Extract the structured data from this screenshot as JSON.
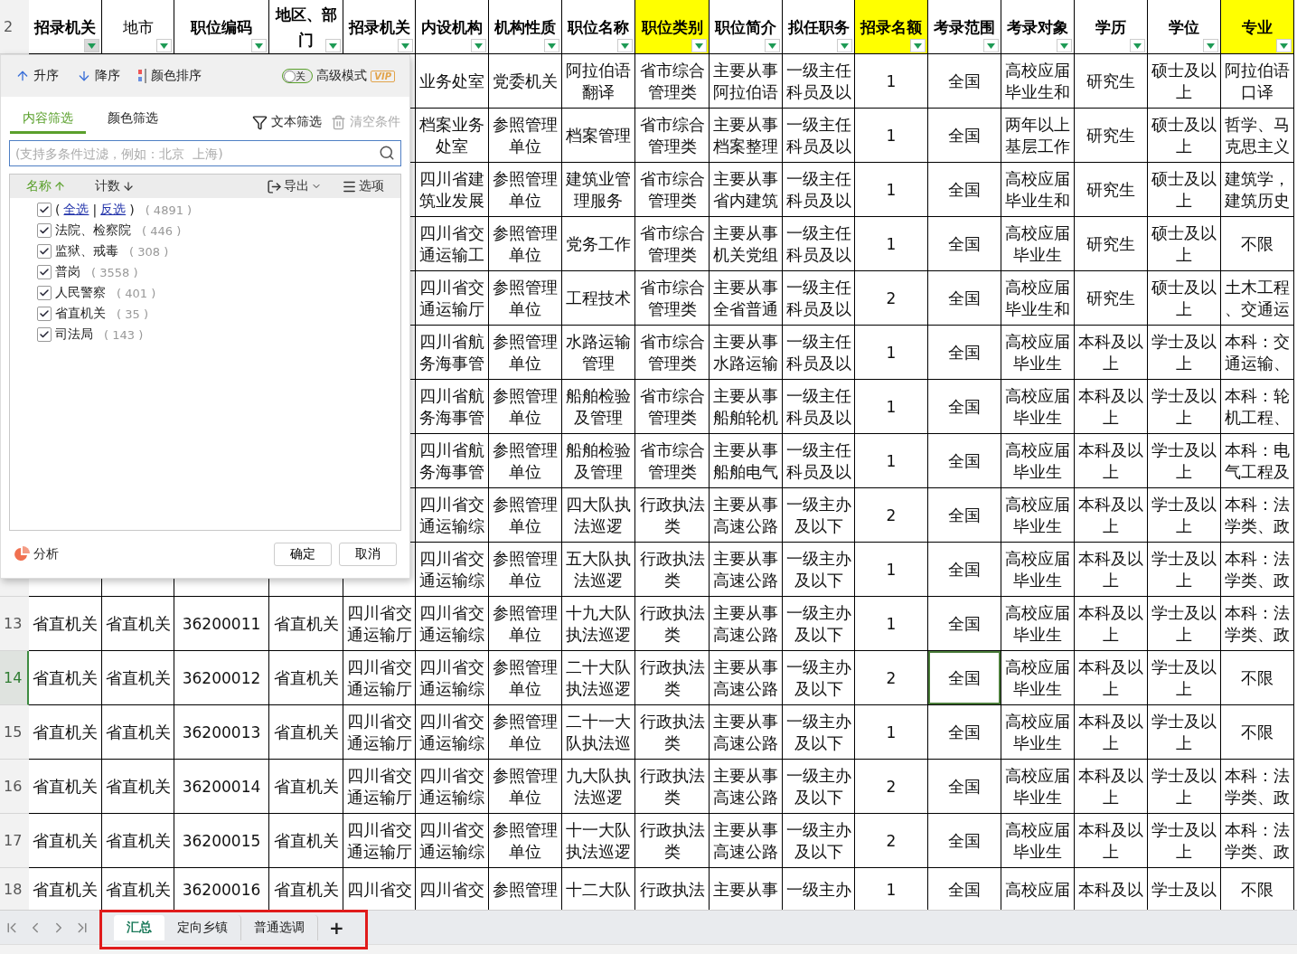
{
  "header_row": {
    "num": "2"
  },
  "columns": [
    {
      "label": "招录机关",
      "bold": true,
      "highlighted": false,
      "filter_open": true
    },
    {
      "label": "地市",
      "bold": false,
      "highlighted": false,
      "filter_open": false
    },
    {
      "label": "职位编码",
      "bold": true,
      "highlighted": false,
      "filter_open": false
    },
    {
      "label": "地区、部门",
      "bold": true,
      "highlighted": false,
      "filter_open": false
    },
    {
      "label": "招录机关",
      "bold": true,
      "highlighted": false,
      "filter_open": false
    },
    {
      "label": "内设机构",
      "bold": true,
      "highlighted": false,
      "filter_open": false
    },
    {
      "label": "机构性质",
      "bold": true,
      "highlighted": false,
      "filter_open": false
    },
    {
      "label": "职位名称",
      "bold": true,
      "highlighted": false,
      "filter_open": false
    },
    {
      "label": "职位类别",
      "bold": true,
      "highlighted": true,
      "filter_open": false
    },
    {
      "label": "职位简介",
      "bold": true,
      "highlighted": false,
      "filter_open": false
    },
    {
      "label": "拟任职务",
      "bold": true,
      "highlighted": false,
      "filter_open": false
    },
    {
      "label": "招录名额",
      "bold": true,
      "highlighted": true,
      "filter_open": false
    },
    {
      "label": "考录范围",
      "bold": true,
      "highlighted": false,
      "filter_open": false
    },
    {
      "label": "考录对象",
      "bold": true,
      "highlighted": false,
      "filter_open": false
    },
    {
      "label": "学历",
      "bold": true,
      "highlighted": false,
      "filter_open": false
    },
    {
      "label": "学位",
      "bold": true,
      "highlighted": false,
      "filter_open": false
    },
    {
      "label": "专业",
      "bold": true,
      "highlighted": true,
      "filter_open": false
    }
  ],
  "rows": [
    {
      "cells": [
        "业务处室",
        "党委机关",
        "阿拉伯语翻译",
        "省市综合管理类",
        "主要从事阿拉伯语",
        "一级主任科员及以",
        "1",
        "全国",
        "高校应届毕业生和",
        "研究生",
        "硕士及以上",
        "阿拉伯语口译"
      ]
    },
    {
      "cells": [
        "档案业务处室",
        "参照管理单位",
        "档案管理",
        "省市综合管理类",
        "主要从事档案整理",
        "一级主任科员及以",
        "1",
        "全国",
        "两年以上基层工作",
        "研究生",
        "硕士及以上",
        "哲学、马克思主义"
      ]
    },
    {
      "cells": [
        "四川省建筑业发展",
        "参照管理单位",
        "建筑业管理服务",
        "省市综合管理类",
        "主要从事省内建筑",
        "一级主任科员及以",
        "1",
        "全国",
        "高校应届毕业生和",
        "研究生",
        "硕士及以上",
        "建筑学，建筑历史"
      ]
    },
    {
      "cells": [
        "四川省交通运输工",
        "参照管理单位",
        "党务工作",
        "省市综合管理类",
        "主要从事机关党组",
        "一级主任科员及以",
        "1",
        "全国",
        "高校应届毕业生",
        "研究生",
        "硕士及以上",
        "不限"
      ]
    },
    {
      "cells": [
        "四川省交通运输厅",
        "参照管理单位",
        "工程技术",
        "省市综合管理类",
        "主要从事全省普通",
        "一级主任科员及以",
        "2",
        "全国",
        "高校应届毕业生和",
        "研究生",
        "硕士及以上",
        "土木工程、交通运"
      ]
    },
    {
      "cells": [
        "四川省航务海事管",
        "参照管理单位",
        "水路运输管理",
        "省市综合管理类",
        "主要从事水路运输",
        "一级主任科员及以",
        "1",
        "全国",
        "高校应届毕业生",
        "本科及以上",
        "学士及以上",
        "本科：交通运输、"
      ]
    },
    {
      "cells": [
        "四川省航务海事管",
        "参照管理单位",
        "船舶检验及管理",
        "省市综合管理类",
        "主要从事船舶轮机",
        "一级主任科员及以",
        "1",
        "全国",
        "高校应届毕业生",
        "本科及以上",
        "学士及以上",
        "本科：轮机工程、"
      ]
    },
    {
      "cells": [
        "四川省航务海事管",
        "参照管理单位",
        "船舶检验及管理",
        "省市综合管理类",
        "主要从事船舶电气",
        "一级主任科员及以",
        "1",
        "全国",
        "高校应届毕业生",
        "本科及以上",
        "学士及以上",
        "本科：电气工程及"
      ]
    },
    {
      "cells": [
        "四川省交通运输综",
        "参照管理单位",
        "四大队执法巡逻",
        "行政执法类",
        "主要从事高速公路",
        "一级主办及以下",
        "2",
        "全国",
        "高校应届毕业生",
        "本科及以上",
        "学士及以上",
        "本科：法学类、政"
      ]
    },
    {
      "cells": [
        "四川省交通运输综",
        "参照管理单位",
        "五大队执法巡逻",
        "行政执法类",
        "主要从事高速公路",
        "一级主办及以下",
        "1",
        "全国",
        "高校应届毕业生",
        "本科及以上",
        "学士及以上",
        "本科：法学类、政"
      ]
    },
    {
      "num": "13",
      "selected": false,
      "cells": [
        "省直机关",
        "省直机关",
        "36200011",
        "省直机关",
        "四川省交通运输厅",
        "四川省交通运输综",
        "参照管理单位",
        "十九大队执法巡逻",
        "行政执法类",
        "主要从事高速公路",
        "一级主办及以下",
        "1",
        "全国",
        "高校应届毕业生",
        "本科及以上",
        "学士及以上",
        "本科：法学类、政"
      ]
    },
    {
      "num": "14",
      "selected": true,
      "cells": [
        "省直机关",
        "省直机关",
        "36200012",
        "省直机关",
        "四川省交通运输厅",
        "四川省交通运输综",
        "参照管理单位",
        "二十大队执法巡逻",
        "行政执法类",
        "主要从事高速公路",
        "一级主办及以下",
        "2",
        {
          "text": "全国",
          "selected": true
        },
        "高校应届毕业生",
        "本科及以上",
        "学士及以上",
        "不限"
      ]
    },
    {
      "num": "15",
      "selected": false,
      "cells": [
        "省直机关",
        "省直机关",
        "36200013",
        "省直机关",
        "四川省交通运输厅",
        "四川省交通运输综",
        "参照管理单位",
        "二十一大队执法巡",
        "行政执法类",
        "主要从事高速公路",
        "一级主办及以下",
        "1",
        "全国",
        "高校应届毕业生",
        "本科及以上",
        "学士及以上",
        "不限"
      ]
    },
    {
      "num": "16",
      "selected": false,
      "cells": [
        "省直机关",
        "省直机关",
        "36200014",
        "省直机关",
        "四川省交通运输厅",
        "四川省交通运输综",
        "参照管理单位",
        "九大队执法巡逻",
        "行政执法类",
        "主要从事高速公路",
        "一级主办及以下",
        "2",
        "全国",
        "高校应届毕业生",
        "本科及以上",
        "学士及以上",
        "本科：法学类、政"
      ]
    },
    {
      "num": "17",
      "selected": false,
      "cells": [
        "省直机关",
        "省直机关",
        "36200015",
        "省直机关",
        "四川省交通运输厅",
        "四川省交通运输综",
        "参照管理单位",
        "十一大队执法巡逻",
        "行政执法类",
        "主要从事高速公路",
        "一级主办及以下",
        "2",
        "全国",
        "高校应届毕业生",
        "本科及以上",
        "学士及以上",
        "本科：法学类、政"
      ]
    },
    {
      "num": "18",
      "selected": false,
      "cells": [
        "省直机关",
        "省直机关",
        "36200016",
        "省直机关",
        "四川省交",
        "四川省交",
        "参照管理",
        "十二大队",
        "行政执法",
        "主要从事",
        "一级主办",
        "1",
        "全国",
        "高校应届",
        "本科及以",
        "学士及以",
        "不限"
      ]
    }
  ],
  "filter_popup": {
    "toolbar": {
      "sort_asc": "升序",
      "sort_desc": "降序",
      "color_sort": "颜色排序",
      "toggle": {
        "label": "关",
        "on": false
      },
      "advanced_mode": "高级模式",
      "badge": "VIP"
    },
    "tabs": [
      {
        "label": "内容筛选",
        "selected": true
      },
      {
        "label": "颜色筛选",
        "selected": false
      }
    ],
    "text_filter": "文本筛选",
    "clear": {
      "label": "清空条件",
      "disabled": true
    },
    "search": {
      "placeholder": "(支持多条件过滤，例如：北京  上海)"
    },
    "list_header": {
      "name": "名称",
      "count": "计数",
      "export": "导出",
      "options": "选项"
    },
    "select_all": {
      "prefix": "(",
      "links": [
        "全选",
        "反选"
      ],
      "separator": "|",
      "suffix": ")",
      "count": "( 4891 )",
      "checked": true
    },
    "items": [
      {
        "label": "法院、检察院",
        "count": "( 446 )",
        "checked": true
      },
      {
        "label": "监狱、戒毒",
        "count": "( 308 )",
        "checked": true
      },
      {
        "label": "普岗",
        "count": "( 3558 )",
        "checked": true
      },
      {
        "label": "人民警察",
        "count": "( 401 )",
        "checked": true
      },
      {
        "label": "省直机关",
        "count": "( 35 )",
        "checked": true
      },
      {
        "label": "司法局",
        "count": "( 143 )",
        "checked": true
      }
    ],
    "analyze": "分析",
    "buttons": [
      "确定",
      "取消"
    ]
  },
  "sheet_tabs": [
    {
      "label": "汇总",
      "selected": true
    },
    {
      "label": "定向乡镇",
      "selected": false
    },
    {
      "label": "普通选调",
      "selected": false
    }
  ],
  "add_sheet": "+"
}
